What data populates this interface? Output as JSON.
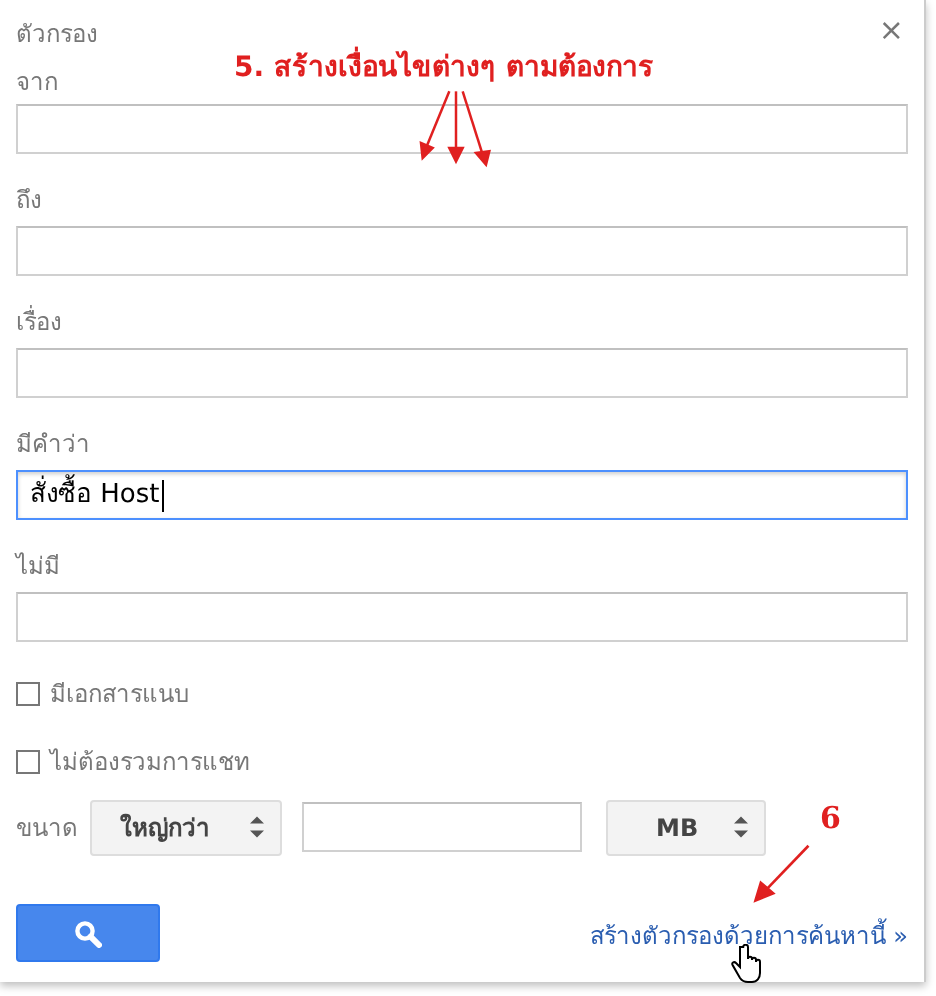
{
  "dialog": {
    "title": "ตัวกรอง",
    "close": "×"
  },
  "fields": [
    {
      "label": "จาก",
      "focused": false
    },
    {
      "label": "ถึง",
      "focused": false
    },
    {
      "label": "เรื่อง",
      "focused": false
    },
    {
      "label": "มีคำว่า",
      "value": "สั่งซื้อ Host",
      "focused": true
    },
    {
      "label": "ไม่มี",
      "focused": false
    }
  ],
  "checkboxes": [
    {
      "label": "มีเอกสารแนบ",
      "checked": false
    },
    {
      "label": "ไม่ต้องรวมการแชท",
      "checked": false
    }
  ],
  "size": {
    "label": "ขนาด",
    "comparator": "ใหญ่กว่า",
    "unit": "MB"
  },
  "create_filter_link": "สร้างตัวกรองด้วยการค้นหานี้ »",
  "annotations": [
    {
      "text": "5. สร้างเงื่อนไขต่างๆ ตามต้องการ"
    },
    {
      "text": "6"
    }
  ]
}
